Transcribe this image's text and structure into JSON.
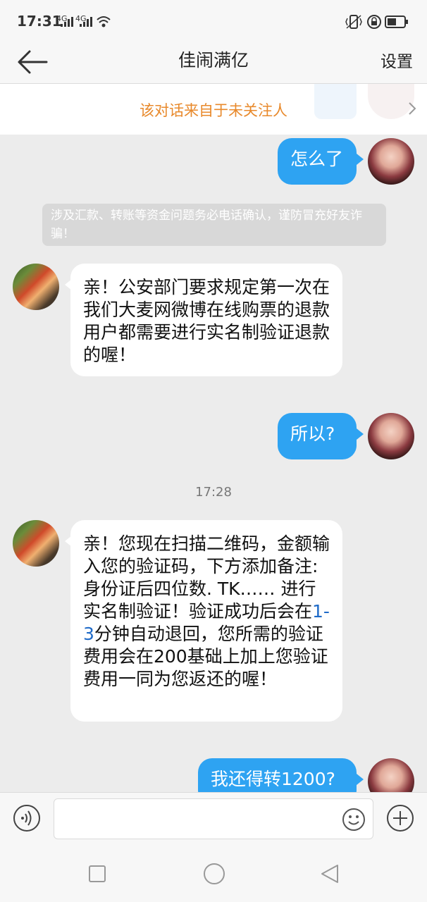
{
  "status_bar": {
    "time": "17:31",
    "signal_1": "4G",
    "signal_2": "4G"
  },
  "header": {
    "title": "佳闹满亿",
    "settings_label": "设置"
  },
  "banner": {
    "text": "该对话来自于未关注人"
  },
  "messages": {
    "m1": "怎么了",
    "notice": "涉及汇款、转账等资金问题务必电话确认，谨防冒充好友诈骗！",
    "m2": "亲！公安部门要求规定第一次在我们大麦网微博在线购票的退款用户都需要进行实名制验证退款的喔！",
    "m3": "所以?",
    "timestamp": "17:28",
    "m4_part1": "亲！您现在扫描二维码，金额输入您的验证码，下方添加备注:身份证后四位数. TK…… 进行实名制验证！验证成功后会在",
    "m4_link": "1-3",
    "m4_part2": "分钟自动退回，您所需的验证费用会在200基础上加上您验证费用一同为您返还的喔！",
    "m5": "我还得转1200?"
  },
  "colors": {
    "outgoing_bubble": "#2ea3f2",
    "incoming_bubble": "#ffffff",
    "banner_text": "#e8892b",
    "background": "#ececec"
  },
  "icons": {
    "back": "arrow-left-icon",
    "voice": "voice-icon",
    "emoji": "emoji-icon",
    "add": "plus-icon",
    "nav_recent": "square-icon",
    "nav_home": "circle-icon",
    "nav_back": "triangle-back-icon"
  }
}
